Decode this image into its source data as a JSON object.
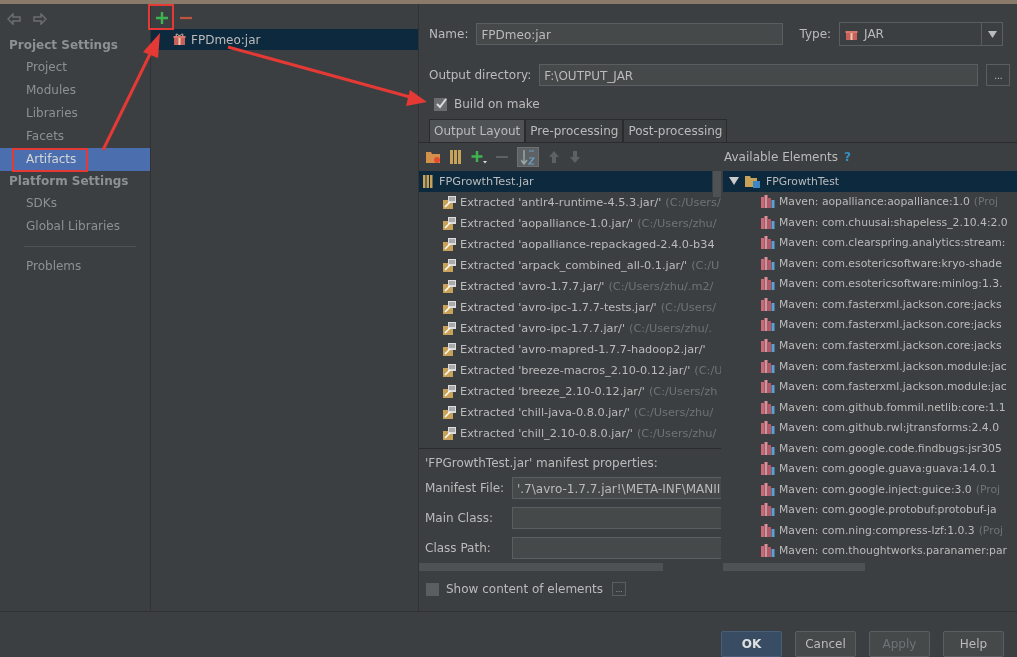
{
  "nav": {
    "sections": [
      {
        "title": "Project Settings",
        "items": [
          {
            "label": "Project",
            "selected": false
          },
          {
            "label": "Modules",
            "selected": false
          },
          {
            "label": "Libraries",
            "selected": false
          },
          {
            "label": "Facets",
            "selected": false
          },
          {
            "label": "Artifacts",
            "selected": true
          }
        ]
      },
      {
        "title": "Platform Settings",
        "items": [
          {
            "label": "SDKs",
            "selected": false
          },
          {
            "label": "Global Libraries",
            "selected": false
          }
        ]
      }
    ],
    "extra_items": [
      {
        "label": "Problems",
        "selected": false
      }
    ]
  },
  "artifacts": [
    {
      "label": "FPDmeo:jar",
      "selected": true
    }
  ],
  "form": {
    "name_label": "Name:",
    "name": "FPDmeo:jar",
    "type_label": "Type:",
    "type": "JAR",
    "output_label": "Output directory:",
    "output": "F:\\OUTPUT_JAR",
    "browse": "...",
    "build_on_make": {
      "label": "Build on make",
      "checked": true
    }
  },
  "tabs": [
    {
      "label": "Output Layout",
      "selected": true
    },
    {
      "label": "Pre-processing",
      "selected": false
    },
    {
      "label": "Post-processing",
      "selected": false
    }
  ],
  "available_label": "Available Elements",
  "help": "?",
  "output_tree": {
    "root": "FPGrowthTest.jar",
    "children": [
      {
        "name": "Extracted 'antlr4-runtime-4.5.3.jar/'",
        "path": "(C:/Users/"
      },
      {
        "name": "Extracted 'aopalliance-1.0.jar/'",
        "path": "(C:/Users/zhu/"
      },
      {
        "name": "Extracted 'aopalliance-repackaged-2.4.0-b34"
      },
      {
        "name": "Extracted 'arpack_combined_all-0.1.jar/'",
        "path": "(C:/U"
      },
      {
        "name": "Extracted 'avro-1.7.7.jar/'",
        "path": "(C:/Users/zhu/.m2/"
      },
      {
        "name": "Extracted 'avro-ipc-1.7.7-tests.jar/'",
        "path": "(C:/Users/"
      },
      {
        "name": "Extracted 'avro-ipc-1.7.7.jar/'",
        "path": "(C:/Users/zhu/."
      },
      {
        "name": "Extracted 'avro-mapred-1.7.7-hadoop2.jar/'"
      },
      {
        "name": "Extracted 'breeze-macros_2.10-0.12.jar/'",
        "path": "(C:/U"
      },
      {
        "name": "Extracted 'breeze_2.10-0.12.jar/'",
        "path": "(C:/Users/zh"
      },
      {
        "name": "Extracted 'chill-java-0.8.0.jar/'",
        "path": "(C:/Users/zhu/"
      },
      {
        "name": "Extracted 'chill_2.10-0.8.0.jar/'",
        "path": "(C:/Users/zhu/"
      }
    ]
  },
  "available_tree": {
    "root": "FPGrowthTest",
    "expanded": true,
    "children": [
      {
        "name": "Maven: aopalliance:aopalliance:1.0",
        "suffix": "(Proj"
      },
      {
        "name": "Maven: com.chuusai:shapeless_2.10.4:2.0"
      },
      {
        "name": "Maven: com.clearspring.analytics:stream:"
      },
      {
        "name": "Maven: com.esotericsoftware:kryo-shade"
      },
      {
        "name": "Maven: com.esotericsoftware:minlog:1.3."
      },
      {
        "name": "Maven: com.fasterxml.jackson.core:jacks"
      },
      {
        "name": "Maven: com.fasterxml.jackson.core:jacks"
      },
      {
        "name": "Maven: com.fasterxml.jackson.core:jacks"
      },
      {
        "name": "Maven: com.fasterxml.jackson.module:jac"
      },
      {
        "name": "Maven: com.fasterxml.jackson.module:jac"
      },
      {
        "name": "Maven: com.github.fommil.netlib:core:1.1"
      },
      {
        "name": "Maven: com.github.rwl:jtransforms:2.4.0"
      },
      {
        "name": "Maven: com.google.code.findbugs:jsr305"
      },
      {
        "name": "Maven: com.google.guava:guava:14.0.1"
      },
      {
        "name": "Maven: com.google.inject:guice:3.0",
        "suffix": "(Proj"
      },
      {
        "name": "Maven: com.google.protobuf:protobuf-ja"
      },
      {
        "name": "Maven: com.ning:compress-lzf:1.0.3",
        "suffix": "(Proj"
      },
      {
        "name": "Maven: com.thoughtworks.paranamer:par"
      }
    ]
  },
  "manifest": {
    "title": "'FPGrowthTest.jar' manifest properties:",
    "fields": [
      {
        "label": "Manifest File:",
        "value": "'.7\\avro-1.7.7.jar!\\META-INF\\MANII"
      },
      {
        "label": "Main Class:"
      },
      {
        "label": "Class Path:"
      }
    ]
  },
  "show_content": {
    "label": "Show content of elements",
    "checked": false
  },
  "show_more": "...",
  "buttons": [
    {
      "label": "OK",
      "kind": "primary",
      "disabled": false
    },
    {
      "label": "Cancel",
      "kind": "normal",
      "disabled": false
    },
    {
      "label": "Apply",
      "kind": "normal",
      "disabled": true
    },
    {
      "label": "Help",
      "kind": "normal",
      "disabled": false
    }
  ]
}
